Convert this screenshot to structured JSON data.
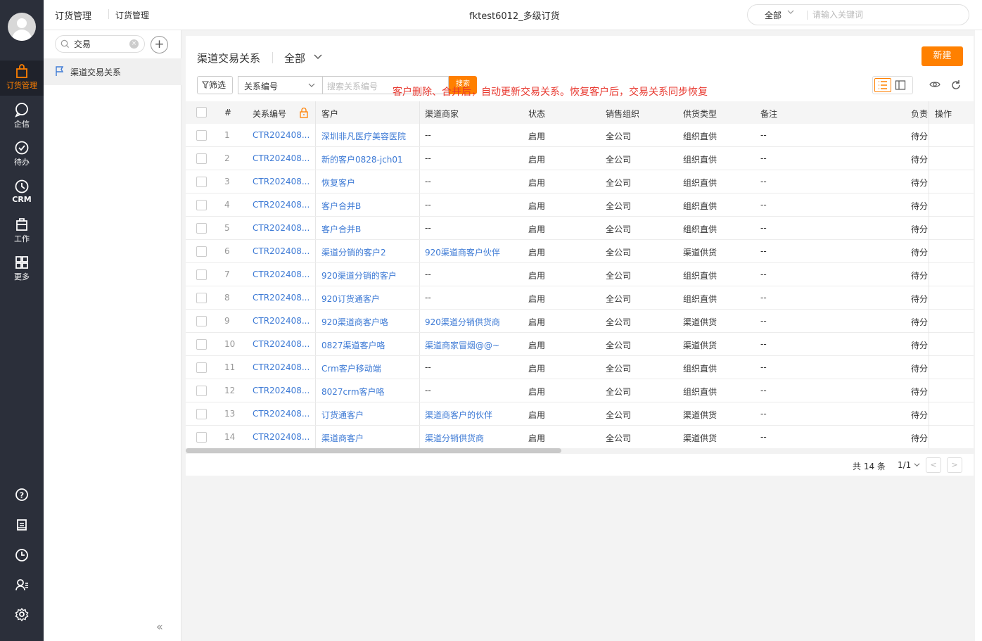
{
  "nav": {
    "items": [
      {
        "label": "订货管理",
        "icon": "bag-icon",
        "active": true
      },
      {
        "label": "企信",
        "icon": "chat-icon"
      },
      {
        "label": "待办",
        "icon": "check-circle-icon"
      },
      {
        "label": "CRM",
        "icon": "clock-icon"
      },
      {
        "label": "工作",
        "icon": "briefcase-icon"
      },
      {
        "label": "更多",
        "icon": "grid-icon"
      }
    ],
    "bottom_icons": [
      "help-icon",
      "document-icon",
      "history-icon",
      "contacts-icon",
      "settings-icon"
    ]
  },
  "topbar": {
    "breadcrumb_1": "订货管理",
    "breadcrumb_2": "订货管理",
    "app_title": "fktest6012_多级订货",
    "search_scope": "全部",
    "search_placeholder": "请输入关键词"
  },
  "subsidebar": {
    "search_value": "交易",
    "items": [
      {
        "label": "渠道交易关系",
        "icon": "flag-icon"
      }
    ],
    "collapse_glyph": "«"
  },
  "page": {
    "title": "渠道交易关系",
    "scene_filter": "全部",
    "new_button": "新建",
    "filter_button": "筛选",
    "field_select": "关系编号",
    "field_placeholder": "搜索关系编号",
    "search_button": "搜索",
    "notice": "客户删除、合并后，自动更新交易关系。恢复客户后，交易关系同步恢复"
  },
  "table": {
    "headers": {
      "index": "#",
      "code": "关系编号",
      "customer": "客户",
      "partner": "渠道商家",
      "status": "状态",
      "org": "销售组织",
      "supply": "供货类型",
      "remark": "备注",
      "owner": "负责",
      "action": "操作"
    },
    "rows": [
      {
        "index": "1",
        "code": "CTR202408...",
        "customer": "深圳非凡医疗美容医院",
        "partner": "--",
        "status": "启用",
        "org": "全公司",
        "supply": "组织直供",
        "remark": "--",
        "owner": "待分"
      },
      {
        "index": "2",
        "code": "CTR202408...",
        "customer": "新的客户0828-jch01",
        "partner": "--",
        "status": "启用",
        "org": "全公司",
        "supply": "组织直供",
        "remark": "--",
        "owner": "待分"
      },
      {
        "index": "3",
        "code": "CTR202408...",
        "customer": "恢复客户",
        "partner": "--",
        "status": "启用",
        "org": "全公司",
        "supply": "组织直供",
        "remark": "--",
        "owner": "待分"
      },
      {
        "index": "4",
        "code": "CTR202408...",
        "customer": "客户合并B",
        "partner": "--",
        "status": "启用",
        "org": "全公司",
        "supply": "组织直供",
        "remark": "--",
        "owner": "待分"
      },
      {
        "index": "5",
        "code": "CTR202408...",
        "customer": "客户合并B",
        "partner": "--",
        "status": "启用",
        "org": "全公司",
        "supply": "组织直供",
        "remark": "--",
        "owner": "待分"
      },
      {
        "index": "6",
        "code": "CTR202408...",
        "customer": "渠道分销的客户2",
        "partner": "920渠道商客户伙伴",
        "status": "启用",
        "org": "全公司",
        "supply": "渠道供货",
        "remark": "--",
        "owner": "待分"
      },
      {
        "index": "7",
        "code": "CTR202408...",
        "customer": "920渠道分销的客户",
        "partner": "--",
        "status": "启用",
        "org": "全公司",
        "supply": "组织直供",
        "remark": "--",
        "owner": "待分"
      },
      {
        "index": "8",
        "code": "CTR202408...",
        "customer": "920订货通客户",
        "partner": "--",
        "status": "启用",
        "org": "全公司",
        "supply": "组织直供",
        "remark": "--",
        "owner": "待分"
      },
      {
        "index": "9",
        "code": "CTR202408...",
        "customer": "920渠道商客户咯",
        "partner": "920渠道分销供货商",
        "status": "启用",
        "org": "全公司",
        "supply": "渠道供货",
        "remark": "--",
        "owner": "待分"
      },
      {
        "index": "10",
        "code": "CTR202408...",
        "customer": "0827渠道客户咯",
        "partner": "渠道商家冒烟@@~",
        "status": "启用",
        "org": "全公司",
        "supply": "渠道供货",
        "remark": "--",
        "owner": "待分"
      },
      {
        "index": "11",
        "code": "CTR202408...",
        "customer": "Crm客户移动端",
        "partner": "--",
        "status": "启用",
        "org": "全公司",
        "supply": "组织直供",
        "remark": "--",
        "owner": "待分"
      },
      {
        "index": "12",
        "code": "CTR202408...",
        "customer": "8027crm客户咯",
        "partner": "--",
        "status": "启用",
        "org": "全公司",
        "supply": "组织直供",
        "remark": "--",
        "owner": "待分"
      },
      {
        "index": "13",
        "code": "CTR202408...",
        "customer": "订货通客户",
        "partner": "渠道商客户的伙伴",
        "status": "启用",
        "org": "全公司",
        "supply": "渠道供货",
        "remark": "--",
        "owner": "待分"
      },
      {
        "index": "14",
        "code": "CTR202408...",
        "customer": "渠道商客户",
        "partner": "渠道分销供货商",
        "status": "启用",
        "org": "全公司",
        "supply": "渠道供货",
        "remark": "--",
        "owner": "待分"
      }
    ]
  },
  "pager": {
    "total": "共 14 条",
    "pages": "1/1",
    "prev": "<",
    "next": ">"
  },
  "colors": {
    "accent": "#ff8000",
    "link": "#3d7ad5",
    "notice": "#e8382f",
    "nav_bg": "#2b2f3a"
  }
}
